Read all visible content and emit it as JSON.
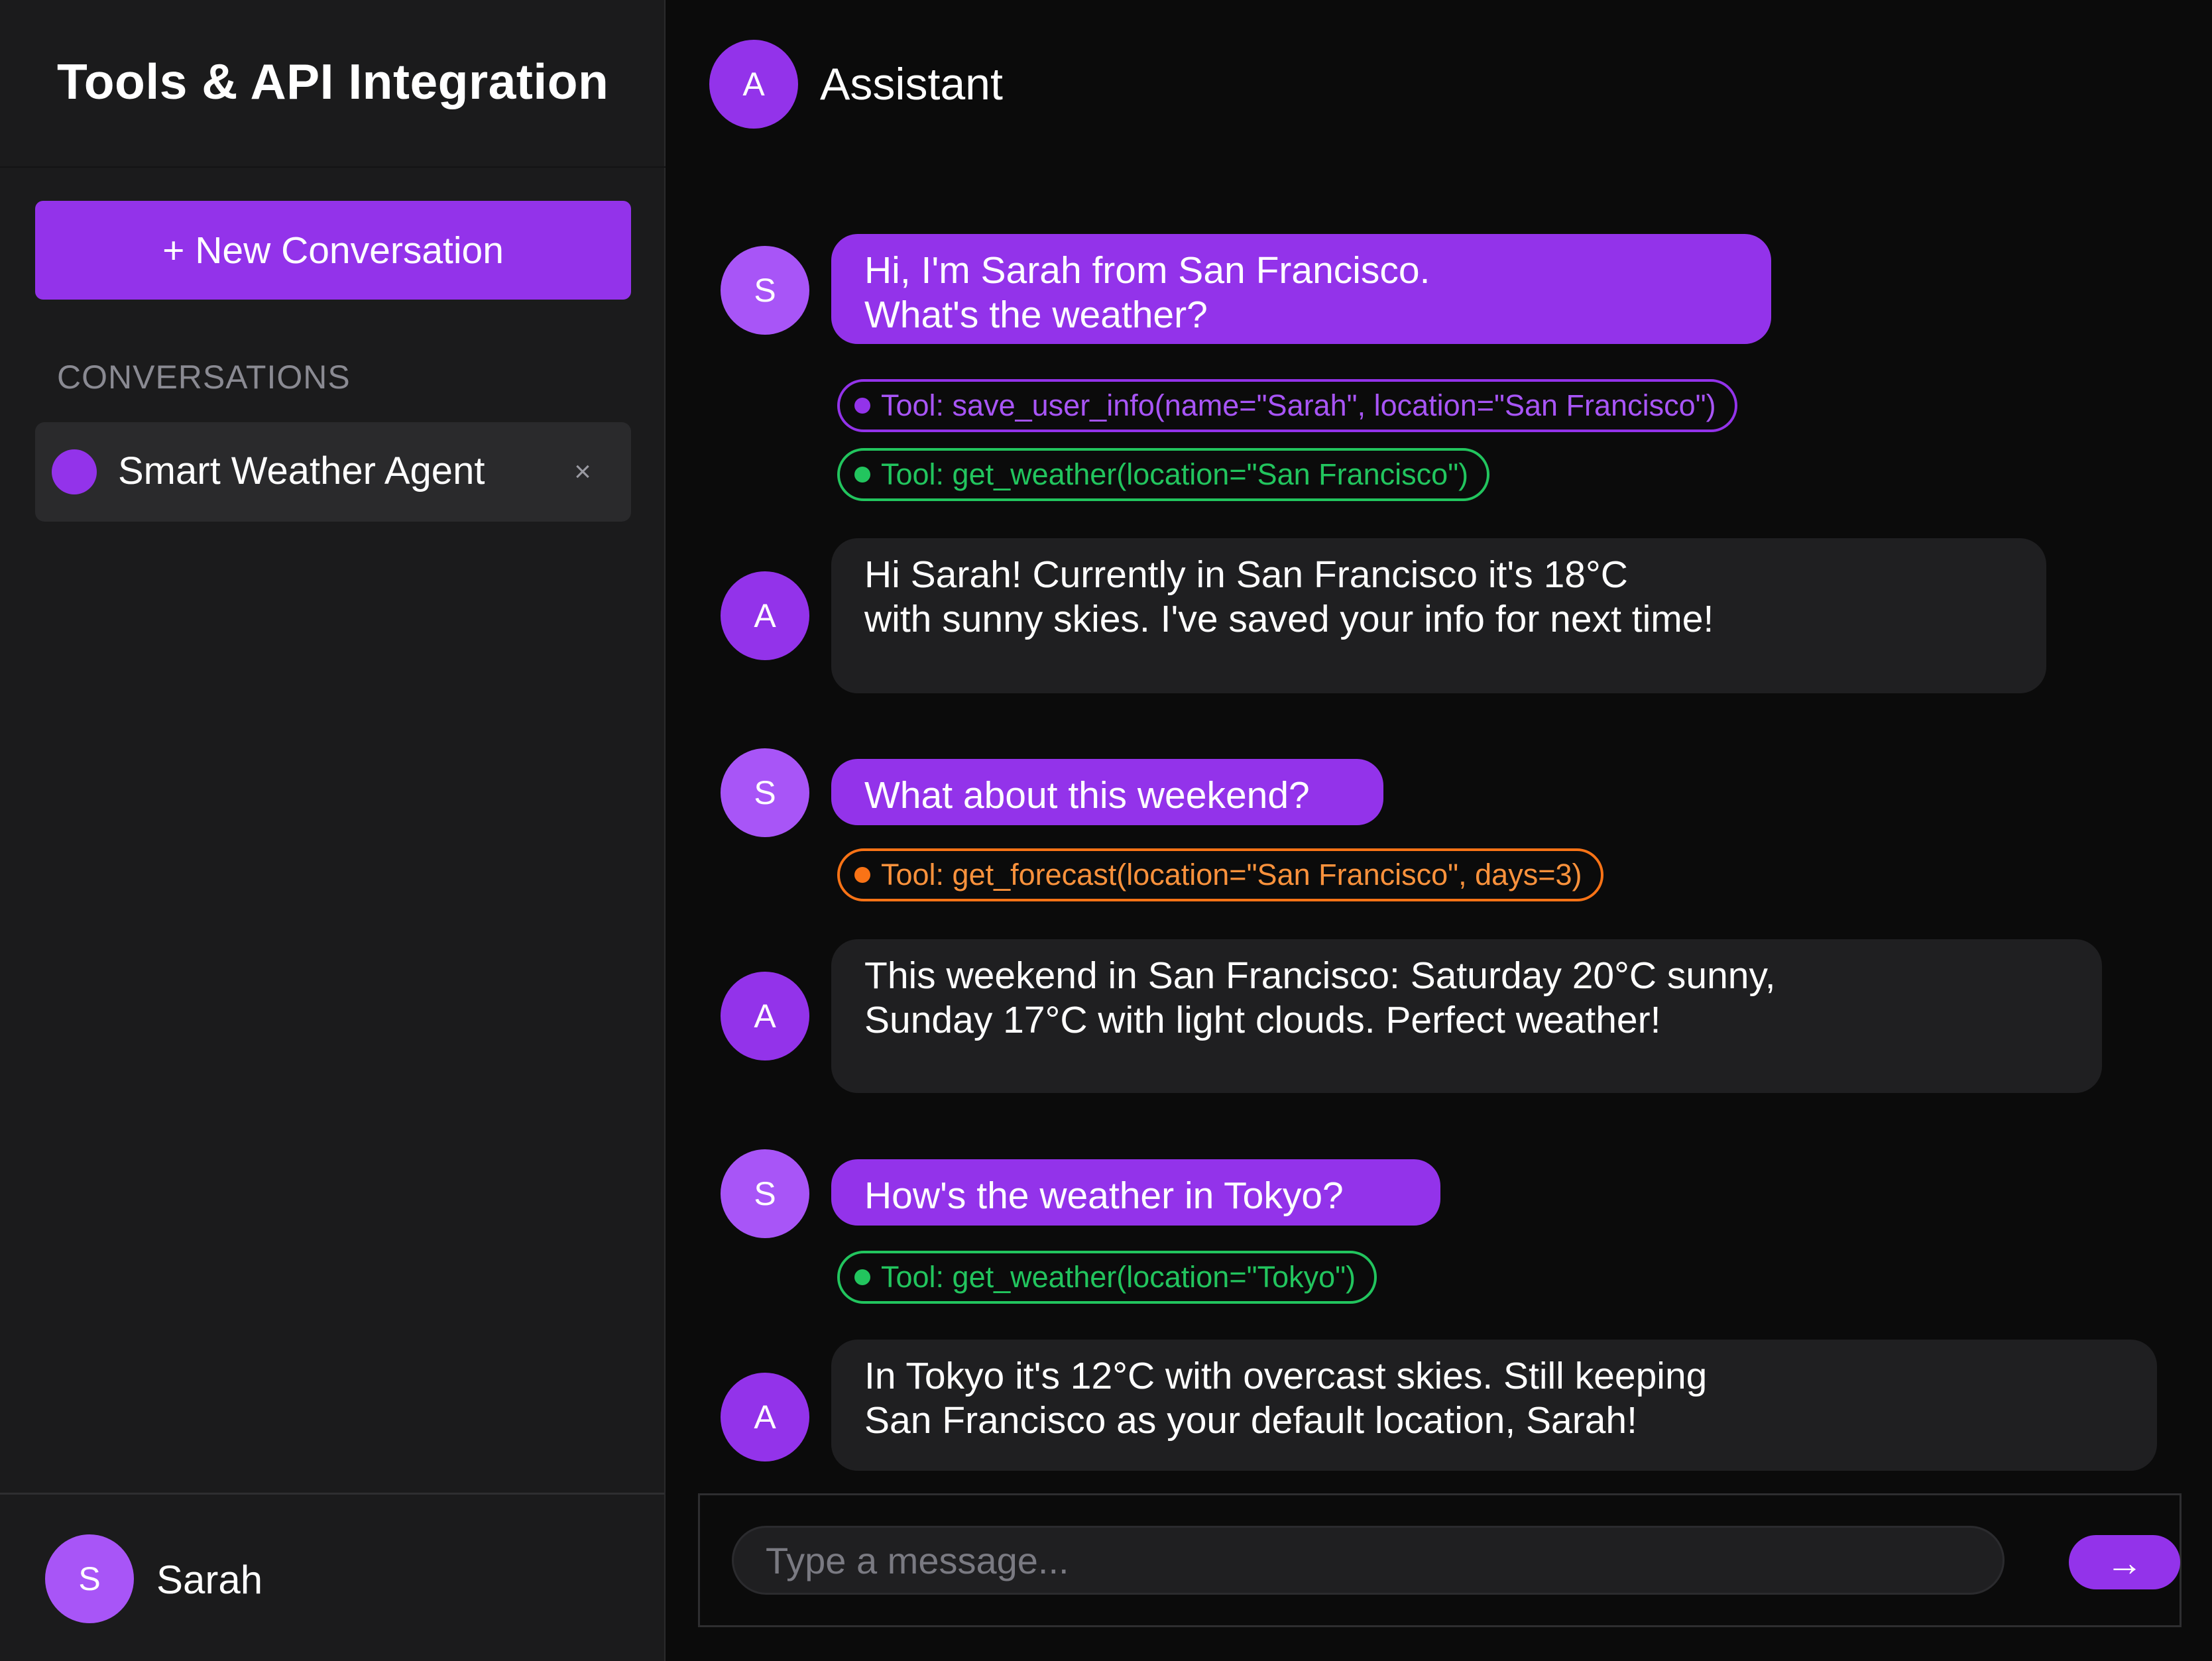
{
  "sidebar": {
    "title": "Tools & API Integration",
    "new_conversation_label": "+ New Conversation",
    "section_label": "CONVERSATIONS",
    "conversations": [
      {
        "label": "Smart Weather Agent",
        "close_glyph": "×",
        "accent": "#9333ea"
      }
    ],
    "user": {
      "initial": "S",
      "name": "Sarah"
    }
  },
  "chat": {
    "header": {
      "initial": "A",
      "title": "Assistant"
    },
    "messages": [
      {
        "role": "user",
        "initial": "S",
        "text": "Hi, I'm Sarah from San Francisco.\nWhat's the weather?"
      },
      {
        "role": "tool",
        "color": "purple",
        "text": "Tool: save_user_info(name=\"Sarah\", location=\"San Francisco\")"
      },
      {
        "role": "tool",
        "color": "green",
        "text": "Tool: get_weather(location=\"San Francisco\")"
      },
      {
        "role": "assistant",
        "initial": "A",
        "text": "Hi Sarah! Currently in San Francisco it's 18°C\nwith sunny skies. I've saved your info for next time!"
      },
      {
        "role": "user",
        "initial": "S",
        "text": "What about this weekend?"
      },
      {
        "role": "tool",
        "color": "orange",
        "text": "Tool: get_forecast(location=\"San Francisco\", days=3)"
      },
      {
        "role": "assistant",
        "initial": "A",
        "text": "This weekend in San Francisco: Saturday 20°C sunny,\nSunday 17°C with light clouds. Perfect weather!"
      },
      {
        "role": "user",
        "initial": "S",
        "text": "How's the weather in Tokyo?"
      },
      {
        "role": "tool",
        "color": "green",
        "text": "Tool: get_weather(location=\"Tokyo\")"
      },
      {
        "role": "assistant",
        "initial": "A",
        "text": "In Tokyo it's 12°C with overcast skies. Still keeping\nSan Francisco as your default location, Sarah!"
      }
    ]
  },
  "input": {
    "placeholder": "Type a message...",
    "value": "",
    "send_glyph": "→"
  },
  "colors": {
    "accent": "#9333ea",
    "user_avatar": "#a855f7",
    "tool_purple": "#9333ea",
    "tool_green": "#22c55e",
    "tool_orange": "#f97316",
    "sidebar_bg": "#1b1b1c",
    "main_bg": "#0b0b0b",
    "assistant_bubble": "#1f1f21"
  }
}
